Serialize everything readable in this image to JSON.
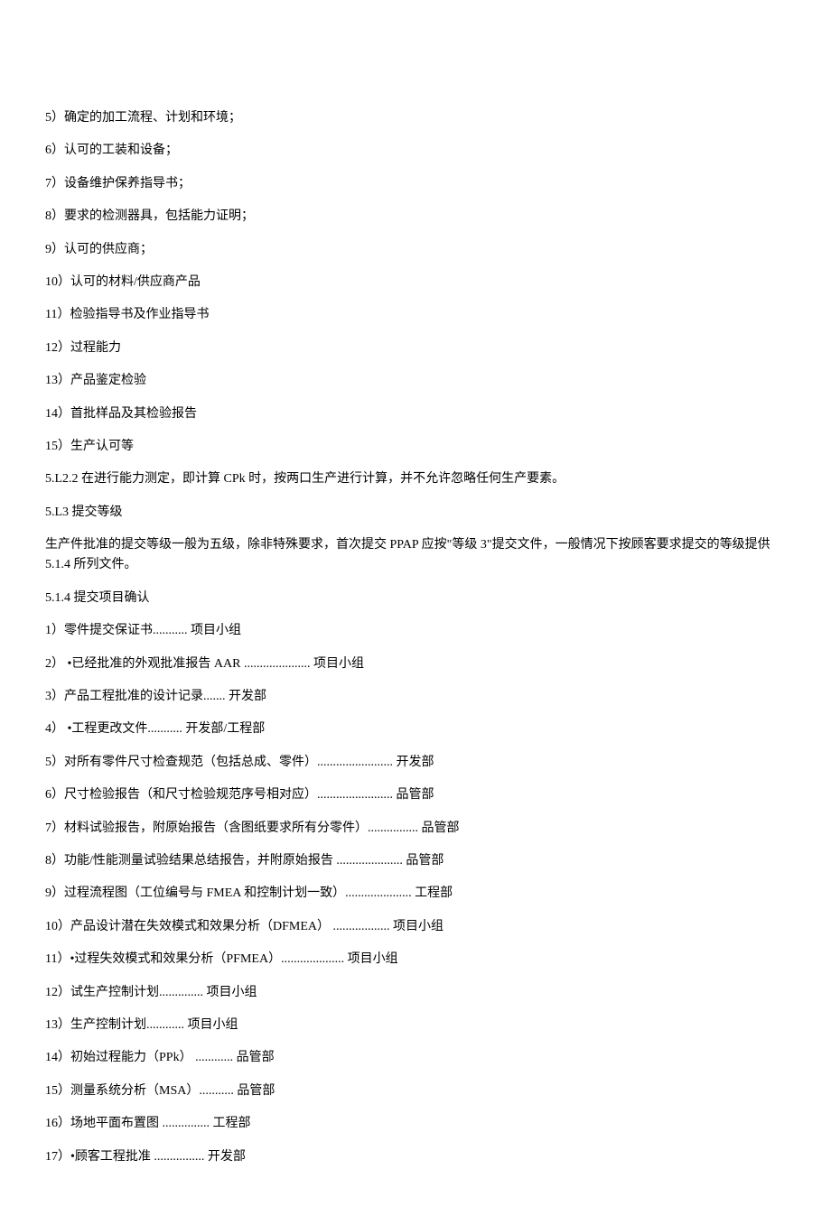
{
  "lines": [
    "5）确定的加工流程、计划和环境；",
    "6）认可的工装和设备；",
    "7）设备维护保养指导书；",
    "8）要求的检测器具，包括能力证明；",
    "9）认可的供应商；",
    "10）认可的材料/供应商产品",
    "11）检验指导书及作业指导书",
    "12）过程能力",
    "13）产品鉴定检验",
    "14）首批样品及其检验报告",
    "15）生产认可等",
    "5.L2.2 在进行能力测定，即计算 CPk 时，按两口生产进行计算，并不允许忽略任何生产要素。",
    "5.L3 提交等级",
    "生产件批准的提交等级一般为五级，除非特殊要求，首次提交 PPAP 应按\"等级 3\"提交文件，一般情况下按顾客要求提交的等级提供 5.1.4 所列文件。",
    "5.1.4 提交项目确认",
    "1）零件提交保证书........... 项目小组",
    "2） •已经批准的外观批准报告 AAR ..................... 项目小组",
    "3）产品工程批准的设计记录....... 开发部",
    "4） •工程更改文件........... 开发部/工程部",
    "5）对所有零件尺寸检查规范（包括总成、零件）........................ 开发部",
    "6）尺寸检验报告（和尺寸检验规范序号相对应）........................ 品管部",
    "7）材料试验报告，附原始报告（含图纸要求所有分零件）................ 品管部",
    "8）功能/性能测量试验结果总结报告，并附原始报告 ..................... 品管部",
    "9）过程流程图（工位编号与 FMEA 和控制计划一致）..................... 工程部",
    "10）产品设计潜在失效模式和效果分析（DFMEA）  .................. 项目小组",
    "11）•过程失效模式和效果分析（PFMEA）.................... 项目小组",
    "12）试生产控制计划.............. 项目小组",
    "13）生产控制计划............ 项目小组",
    "14）初始过程能力（PPk） ............ 品管部",
    "15）测量系统分析（MSA）........... 品管部",
    "16）场地平面布置图 ............... 工程部",
    "17）•顾客工程批准 ................ 开发部"
  ]
}
